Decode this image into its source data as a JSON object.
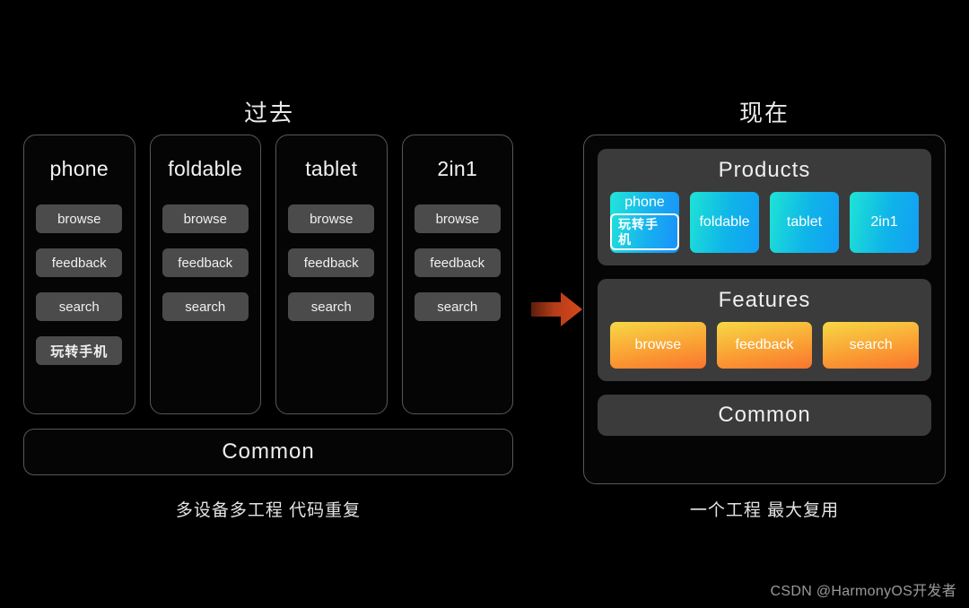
{
  "past": {
    "heading": "过去",
    "caption": "多设备多工程 代码重复",
    "common_label": "Common",
    "columns": [
      {
        "title": "phone",
        "items": [
          "browse",
          "feedback",
          "search",
          "玩转手机"
        ]
      },
      {
        "title": "foldable",
        "items": [
          "browse",
          "feedback",
          "search"
        ]
      },
      {
        "title": "tablet",
        "items": [
          "browse",
          "feedback",
          "search"
        ]
      },
      {
        "title": "2in1",
        "items": [
          "browse",
          "feedback",
          "search"
        ]
      }
    ]
  },
  "arrow": {
    "icon": "arrow-right-icon",
    "color": "#c0401a"
  },
  "now": {
    "heading": "现在",
    "caption": "一个工程 最大复用",
    "common_label": "Common",
    "products": {
      "title": "Products",
      "cards": [
        {
          "label": "phone",
          "badge": "玩转手机"
        },
        {
          "label": "foldable"
        },
        {
          "label": "tablet"
        },
        {
          "label": "2in1"
        }
      ]
    },
    "features": {
      "title": "Features",
      "cards": [
        {
          "label": "browse"
        },
        {
          "label": "feedback"
        },
        {
          "label": "search"
        }
      ]
    }
  },
  "colors": {
    "background": "#000000",
    "panel_border": "#585858",
    "chip": "#4b4b4b",
    "group_box": "#3b3b3b",
    "product_gradient_start": "#1fe3d6",
    "product_gradient_end": "#139ef6",
    "feature_gradient_start": "#f6d845",
    "feature_gradient_end": "#f97430",
    "arrow": "#c0401a"
  },
  "watermark": "CSDN @HarmonyOS开发者"
}
